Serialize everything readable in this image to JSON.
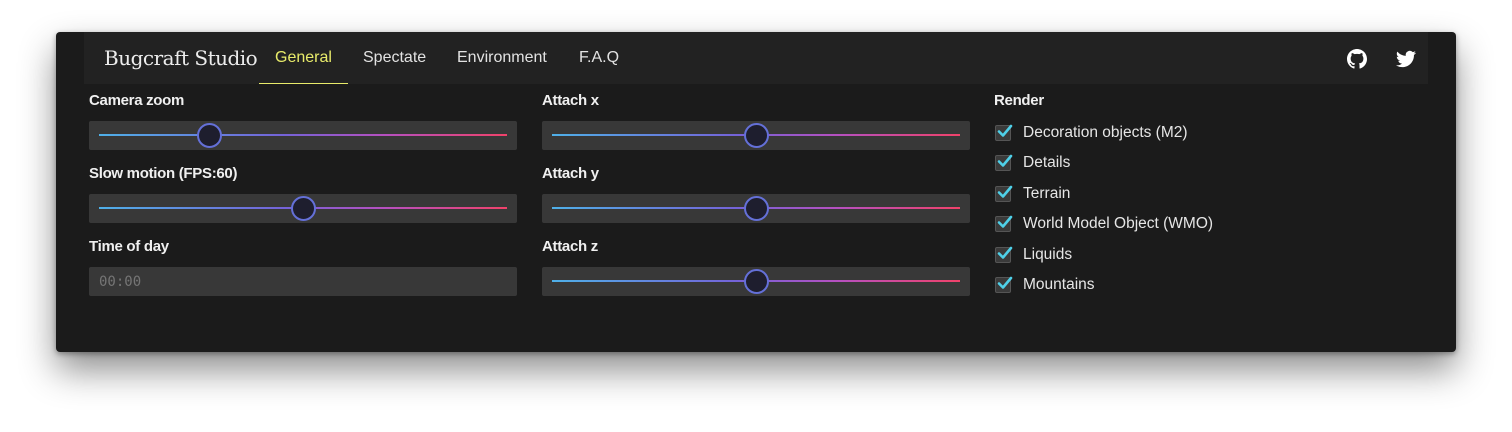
{
  "header": {
    "brand": "Bugcraft Studio",
    "tabs": [
      {
        "label": "General",
        "active": true
      },
      {
        "label": "Spectate",
        "active": false
      },
      {
        "label": "Environment",
        "active": false
      },
      {
        "label": "F.A.Q",
        "active": false
      }
    ],
    "icons": [
      "github-icon",
      "twitter-icon"
    ]
  },
  "colors": {
    "accent": "#e8eb6a",
    "slider_gradient": [
      "#4fb0e8",
      "#7463d8",
      "#b650c0",
      "#f0426a"
    ],
    "thumb_border": "#6470d8",
    "checkbox_check": "#4fd0e8"
  },
  "controls": {
    "camera_zoom": {
      "label": "Camera zoom",
      "value_fraction": 0.27
    },
    "slow_motion": {
      "label": "Slow motion (FPS:60)",
      "value_fraction": 0.5
    },
    "time_of_day": {
      "label": "Time of day",
      "placeholder": "00:00"
    },
    "attach_x": {
      "label": "Attach x",
      "value_fraction": 0.5
    },
    "attach_y": {
      "label": "Attach y",
      "value_fraction": 0.5
    },
    "attach_z": {
      "label": "Attach z",
      "value_fraction": 0.5
    }
  },
  "render": {
    "title": "Render",
    "items": [
      {
        "label": "Decoration objects (M2)",
        "checked": true
      },
      {
        "label": "Details",
        "checked": true
      },
      {
        "label": "Terrain",
        "checked": true
      },
      {
        "label": "World Model Object (WMO)",
        "checked": true
      },
      {
        "label": "Liquids",
        "checked": true
      },
      {
        "label": "Mountains",
        "checked": true
      }
    ]
  }
}
